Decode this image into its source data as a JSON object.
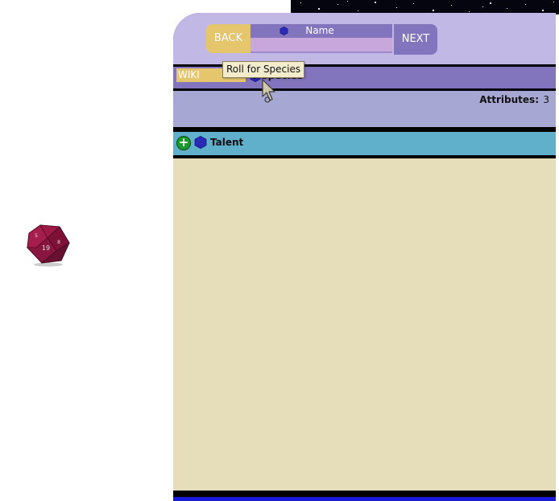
{
  "header": {
    "back_label": "BACK",
    "next_label": "NEXT",
    "name_label": "Name",
    "name_value": ""
  },
  "species_row": {
    "wiki_label": "WIKI",
    "visible_label": "r Species"
  },
  "attributes": {
    "label": "Attributes:",
    "value": "3"
  },
  "talent": {
    "label": "Talent"
  },
  "tooltip": {
    "text": "Roll for Species"
  },
  "dice": {
    "faces": [
      "19",
      "5",
      "8"
    ]
  },
  "colors": {
    "header_bg": "#c2b8e6",
    "accent_purple": "#8274bd",
    "gold": "#e6c66c",
    "attributes_bg": "#a6a7d2",
    "talent_bg": "#60b0cb",
    "content_bg": "#e6ddba",
    "hex_icon": "#2a2ab8"
  }
}
